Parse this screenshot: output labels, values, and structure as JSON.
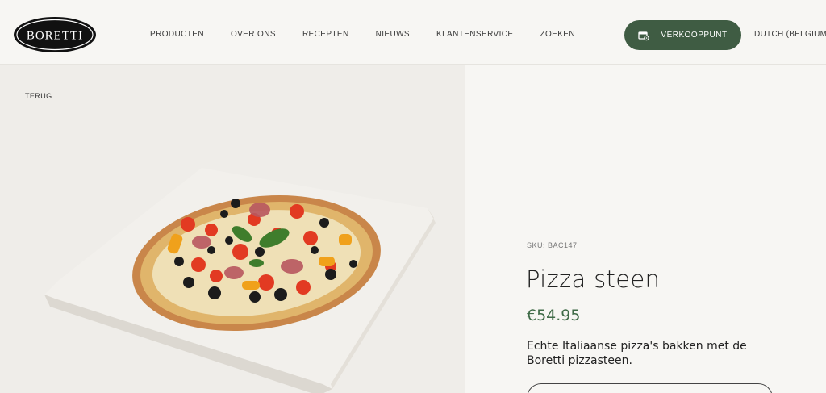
{
  "brand": {
    "logo_text": "BORETTI"
  },
  "nav": {
    "items": [
      {
        "label": "PRODUCTEN"
      },
      {
        "label": "OVER ONS"
      },
      {
        "label": "RECEPTEN"
      },
      {
        "label": "NIEUWS"
      },
      {
        "label": "KLANTENSERVICE"
      },
      {
        "label": "ZOEKEN"
      }
    ]
  },
  "header": {
    "store_button_label": "VERKOOPPUNT",
    "store_icon": "store-locator-icon",
    "language_label": "DUTCH (BELGIUM)"
  },
  "product": {
    "back_label": "TERUG",
    "sku": "SKU: BAC147",
    "title": "Pizza steen",
    "price": "€54.95",
    "description": "Echte Italiaanse pizza's bakken met de Boretti pizzasteen.",
    "image_icon": "pizza-stone-product-image"
  },
  "colors": {
    "accent_green": "#3f5c43",
    "price_green": "#3f6b47",
    "background": "#f7f6f3",
    "image_background": "#efede9"
  }
}
